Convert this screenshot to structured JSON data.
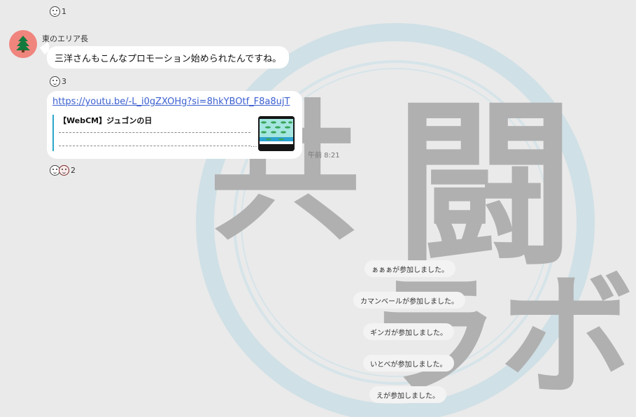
{
  "watermark": {
    "line1a": "共",
    "line1b": "闘",
    "line2": "ラボ"
  },
  "reactions": [
    {
      "icons": [
        "smile-face"
      ],
      "count": "1"
    },
    {
      "icons": [
        "smile-face"
      ],
      "count": "3"
    },
    {
      "icons": [
        "smile-face",
        "bear-face"
      ],
      "count": "2"
    }
  ],
  "message": {
    "sender_name": "東のエリア長",
    "avatar_icon": "tree-icon",
    "text": "三洋さんもこんなプロモーション始められたんですね。",
    "link": {
      "url": "https://youtu.be/-L_i0gZXOHg?si=8hkYBOtf_F8a8ujT",
      "preview_title": "【WebCM】ジュゴンの日",
      "preview_ellipsis": "..."
    },
    "timestamp": "午前 8:21"
  },
  "system_messages": [
    "ぁぁぁが参加しました。",
    "カマンベールが参加しました。",
    "ギンガが参加しました。",
    "いとべが参加しました。",
    "えが参加しました。"
  ],
  "colors": {
    "background": "#eaeaea",
    "avatar": "#f0857e",
    "link": "#3a5fd0",
    "watermark_ring": "#cfe0e6",
    "watermark_glyph": "#b0b0b0"
  }
}
